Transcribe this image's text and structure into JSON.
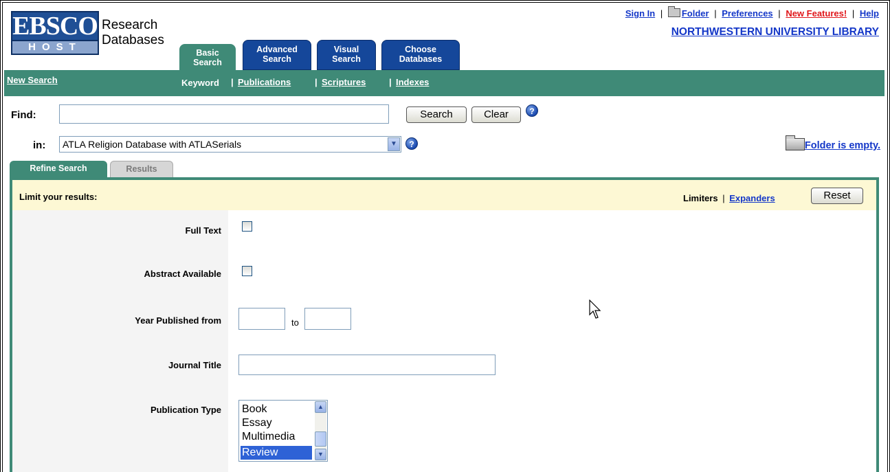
{
  "logo": {
    "brand_top": "EBSCO",
    "brand_bottom": "HOST",
    "line1": "Research",
    "line2": "Databases"
  },
  "main_tabs": [
    {
      "label_1": "Basic",
      "label_2": "Search",
      "active": true
    },
    {
      "label_1": "Advanced",
      "label_2": "Search",
      "active": false
    },
    {
      "label_1": "Visual",
      "label_2": "Search",
      "active": false
    },
    {
      "label_1": "Choose",
      "label_2": "Databases",
      "active": false
    }
  ],
  "top_links": {
    "sign_in": "Sign In",
    "folder": "Folder",
    "preferences": "Preferences",
    "new_features": "New Features!",
    "help": "Help",
    "separator": "|"
  },
  "institution": "NORTHWESTERN UNIVERSITY LIBRARY",
  "nav": {
    "new_search": "New Search",
    "keyword": "Keyword",
    "publications": "Publications",
    "scriptures": "Scriptures",
    "indexes": "Indexes",
    "separator": "|"
  },
  "search": {
    "find_label": "Find:",
    "find_value": "",
    "search_button": "Search",
    "clear_button": "Clear",
    "help_glyph": "?",
    "in_label": "in:",
    "database": "ATLA Religion Database with ATLASerials",
    "dropdown_glyph": "▼"
  },
  "folder_status": "Folder is empty.",
  "sub_tabs": {
    "refine": "Refine Search",
    "results": "Results"
  },
  "limits": {
    "header": "Limit your results:",
    "limiters": "Limiters",
    "separator": "|",
    "expanders": "Expanders",
    "reset": "Reset",
    "full_text": {
      "label": "Full Text",
      "checked": false
    },
    "abstract": {
      "label": "Abstract Available",
      "checked": false
    },
    "year": {
      "label": "Year Published from",
      "from": "",
      "to_label": "to",
      "to": ""
    },
    "journal": {
      "label": "Journal Title",
      "value": ""
    },
    "publication_type": {
      "label": "Publication Type",
      "options": [
        "Book",
        "Essay",
        "Multimedia",
        "Review"
      ],
      "selected": "Review",
      "scroll_up_glyph": "▲",
      "scroll_down_glyph": "▼"
    }
  },
  "colors": {
    "green": "#3f8a77",
    "blue_tab": "#15479a",
    "link": "#1437c8",
    "new_features": "#e0161a",
    "limit_bar": "#fdf8d4"
  }
}
